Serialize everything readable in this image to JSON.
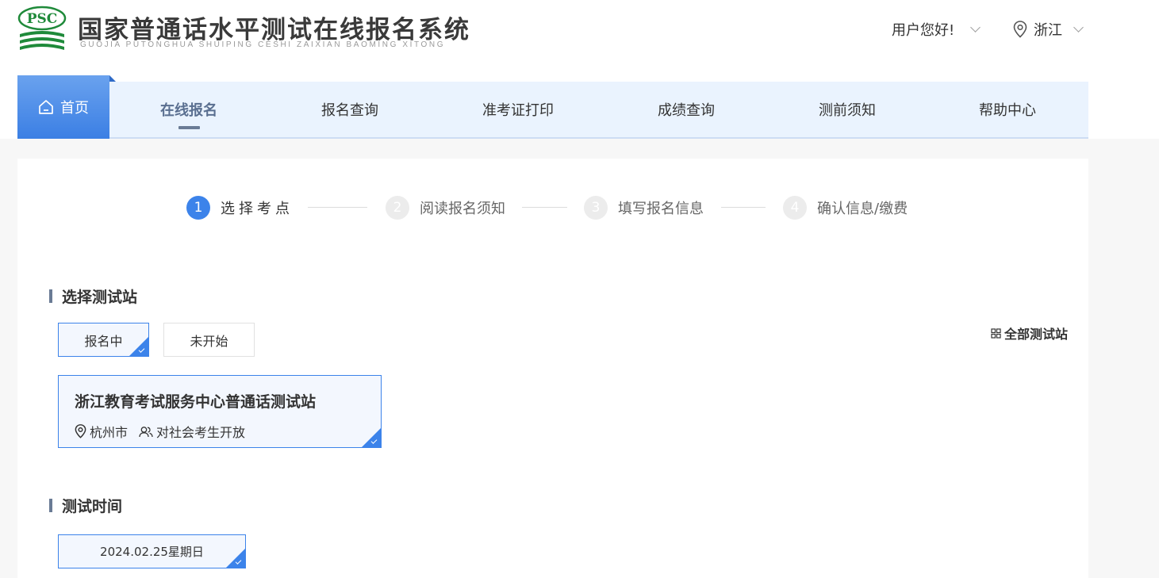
{
  "header": {
    "logo_text": "PSC",
    "title": "国家普通话水平测试在线报名系统",
    "subtitle": "GUOJIA PUTONGHUA SHUIPING CESHI ZAIXIAN BAOMING XITONG",
    "greeting": "用户您好!",
    "region": "浙江",
    "colors": {
      "accent": "#3c83ea",
      "nav_bg": "#eaf3fe",
      "active_nav": "#5a6f90"
    }
  },
  "nav": {
    "home": "首页",
    "items": [
      {
        "label": "在线报名",
        "active": true
      },
      {
        "label": "报名查询"
      },
      {
        "label": "准考证打印"
      },
      {
        "label": "成绩查询"
      },
      {
        "label": "测前须知"
      },
      {
        "label": "帮助中心"
      }
    ]
  },
  "steps": [
    {
      "num": "1",
      "label": "选择考点",
      "active": true
    },
    {
      "num": "2",
      "label": "阅读报名须知"
    },
    {
      "num": "3",
      "label": "填写报名信息"
    },
    {
      "num": "4",
      "label": "确认信息/缴费"
    }
  ],
  "station_section": {
    "title": "选择测试站",
    "tabs": [
      {
        "label": "报名中",
        "selected": true
      },
      {
        "label": "未开始"
      }
    ],
    "all_stations": "全部测试站",
    "station": {
      "name": "浙江教育考试服务中心普通话测试站",
      "city": "杭州市",
      "audience": "对社会考生开放"
    }
  },
  "time_section": {
    "title": "测试时间",
    "date": "2024.02.25星期日"
  }
}
